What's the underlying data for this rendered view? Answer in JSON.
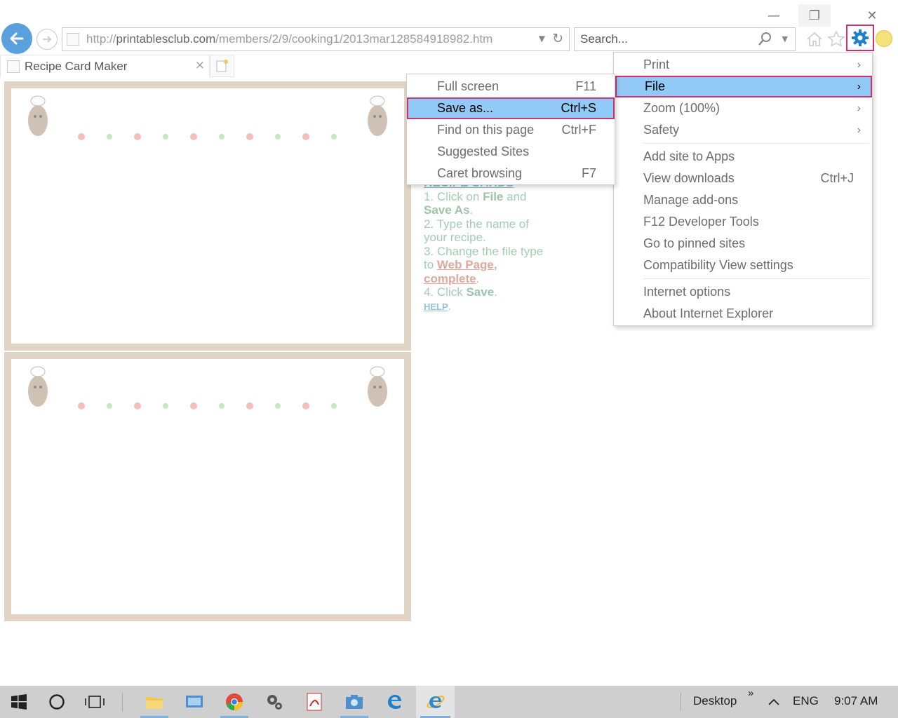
{
  "browser": {
    "address_url_prefix": "http://",
    "address_url_domain": "printablesclub.com",
    "address_url_path": "/members/2/9/cooking1/2013mar128584918982.htm",
    "search_placeholder": "Search...",
    "tab_title": "Recipe Card Maker"
  },
  "window_controls": {
    "minimize_glyph": "—",
    "restore_glyph": "❐",
    "close_glyph": "✕"
  },
  "page": {
    "instructions": {
      "heading": "RECIPE CARDS",
      "step1_prefix": "1. Click on ",
      "step1_file": "File",
      "step1_and": " and",
      "step1_save_as": "Save As",
      "step1_end": ".",
      "step2": "2. Type the name of your recipe.",
      "step3_prefix": "3. Change the file type to ",
      "step3_link": "Web Page, complete",
      "step3_end": ".",
      "step4_prefix": "4. Click ",
      "step4_save": "Save",
      "step4_end": ".",
      "help": "HELP",
      "help_end": "."
    }
  },
  "tools_menu": {
    "items": [
      {
        "label": "Print",
        "arrow": "›"
      },
      {
        "label": "File",
        "arrow": "›",
        "highlighted": true
      },
      {
        "label": "Zoom (100%)",
        "arrow": "›"
      },
      {
        "label": "Safety",
        "arrow": "›"
      },
      {
        "label": "Add site to Apps"
      },
      {
        "label": "View downloads",
        "shortcut": "Ctrl+J"
      },
      {
        "label": "Manage add-ons"
      },
      {
        "label": "F12 Developer Tools"
      },
      {
        "label": "Go to pinned sites"
      },
      {
        "label": "Compatibility View settings"
      },
      {
        "label": "Internet options"
      },
      {
        "label": "About Internet Explorer"
      }
    ]
  },
  "file_submenu": {
    "items": [
      {
        "label": "Full screen",
        "shortcut": "F11"
      },
      {
        "label": "Save as...",
        "shortcut": "Ctrl+S",
        "highlighted": true
      },
      {
        "label": "Find on this page",
        "shortcut": "Ctrl+F"
      },
      {
        "label": "Suggested Sites"
      },
      {
        "label": "Caret browsing",
        "shortcut": "F7"
      }
    ]
  },
  "taskbar": {
    "desktop_label": "Desktop",
    "chevron": "»",
    "lang": "ENG",
    "time": "9:07 AM"
  },
  "colors": {
    "highlight": "#91c9f7",
    "highlight_border": "#d0306c",
    "ie_blue": "#1e7fcb"
  }
}
